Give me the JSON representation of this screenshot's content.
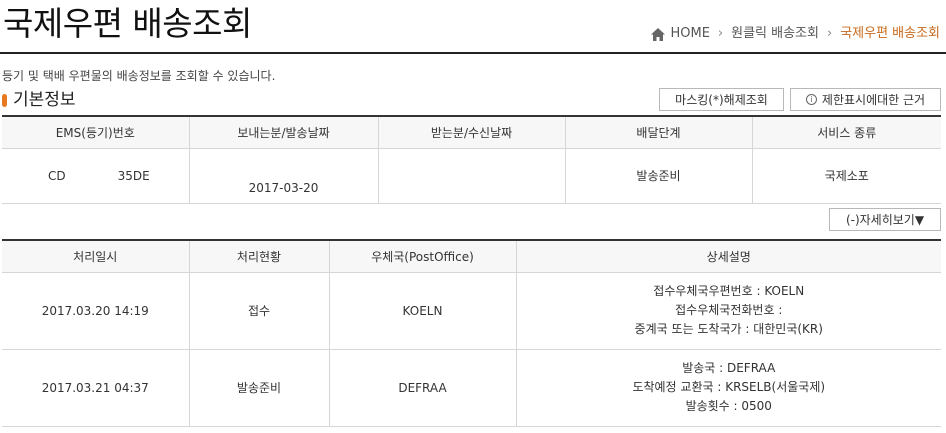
{
  "header": {
    "title": "국제우편 배송조회",
    "breadcrumb": [
      "HOME",
      "원클릭 배송조회",
      "국제우편 배송조회"
    ]
  },
  "description": "등기 및 택배 우편물의 배송정보를 조회할 수 있습니다.",
  "section": {
    "title": "기본정보",
    "unmask_label": "마스킹(*)해제조회",
    "restriction_label": "제한표시에대한 근거",
    "detail_toggle_label": "(-)자세히보기▼"
  },
  "basic_table": {
    "headers": [
      "EMS(등기)번호",
      "보내는분/발송날짜",
      "받는분/수신날짜",
      "배달단계",
      "서비스 종류"
    ],
    "row": {
      "ems_prefix": "CD",
      "ems_suffix": "35DE",
      "sent_date": "2017-03-20",
      "received": "",
      "stage": "발송준비",
      "service": "국제소포"
    }
  },
  "history_table": {
    "headers": [
      "처리일시",
      "처리현황",
      "우체국(PostOffice)",
      "상세설명"
    ],
    "rows": [
      {
        "datetime": "2017.03.20 14:19",
        "status": "접수",
        "office": "KOELN",
        "details": [
          "접수우체국우편번호 : KOELN",
          "접수우체국전화번호 :",
          "중계국 또는 도착국가 : 대한민국(KR)"
        ]
      },
      {
        "datetime": "2017.03.21 04:37",
        "status": "발송준비",
        "office": "DEFRAA",
        "details": [
          "발송국 : DEFRAA",
          "도착예정 교환국 : KRSELB(서울국제)",
          "발송횟수 : 0500"
        ]
      }
    ]
  },
  "icons": {
    "home": "home-icon",
    "breadcrumb_separator": "chevron-right-icon",
    "info": "info-icon"
  },
  "colors": {
    "accent": "#e8791e",
    "breadcrumb_current": "#c96a1d",
    "rule": "#222222"
  }
}
